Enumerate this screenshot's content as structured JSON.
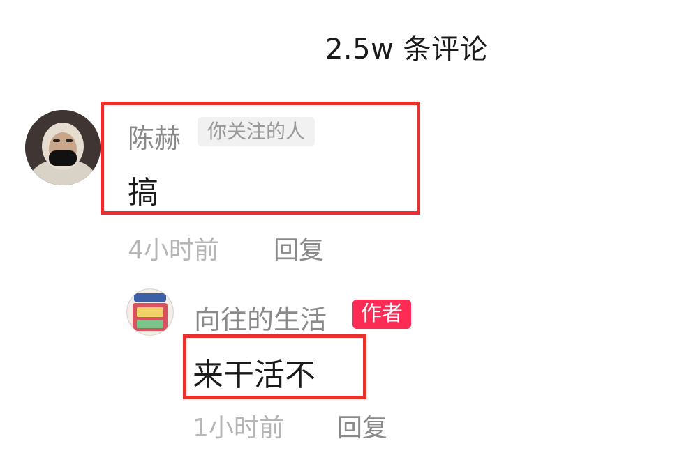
{
  "header": {
    "comment_count": "2.5w 条评论"
  },
  "comments": [
    {
      "username": "陈赫",
      "tag": "你关注的人",
      "text": "搞",
      "time": "4小时前",
      "reply_label": "回复"
    },
    {
      "username": "向往的生活",
      "tag": "作者",
      "text": "来干活不",
      "time": "1小时前",
      "reply_label": "回复"
    }
  ],
  "colors": {
    "highlight_box": "#e8312f",
    "author_tag": "#fe2c55",
    "follow_tag_bg": "#f1f1f1"
  }
}
